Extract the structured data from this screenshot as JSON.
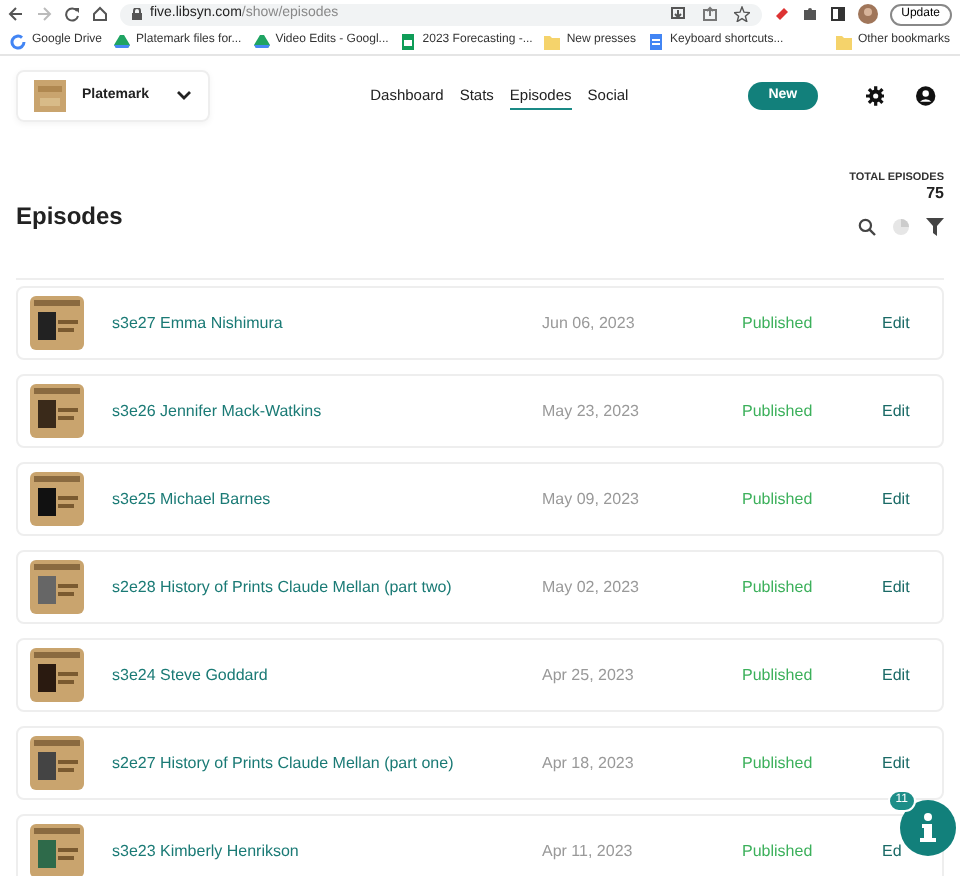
{
  "browser": {
    "url_host": "five.libsyn.com",
    "url_path": "/show/episodes",
    "update_label": "Update",
    "bookmarks": [
      {
        "label": "Google Drive",
        "kind": "google"
      },
      {
        "label": "Platemark files for...",
        "kind": "drive"
      },
      {
        "label": "Video Edits - Googl...",
        "kind": "drive"
      },
      {
        "label": "2023 Forecasting -...",
        "kind": "sheet"
      },
      {
        "label": "New presses",
        "kind": "folder"
      },
      {
        "label": "Keyboard shortcuts...",
        "kind": "doc"
      }
    ],
    "other_bookmarks": "Other bookmarks"
  },
  "show_selector": {
    "name": "Platemark"
  },
  "nav": [
    {
      "label": "Dashboard",
      "selected": false
    },
    {
      "label": "Stats",
      "selected": false
    },
    {
      "label": "Episodes",
      "selected": true
    },
    {
      "label": "Social",
      "selected": false
    }
  ],
  "new_button": "New",
  "page_title": "Episodes",
  "total": {
    "label": "TOTAL EPISODES",
    "value": "75"
  },
  "episodes": [
    {
      "title": "s3e27 Emma Nishimura",
      "date": "Jun 06, 2023",
      "status": "Published",
      "action": "Edit"
    },
    {
      "title": "s3e26 Jennifer Mack-Watkins",
      "date": "May 23, 2023",
      "status": "Published",
      "action": "Edit"
    },
    {
      "title": "s3e25 Michael Barnes",
      "date": "May 09, 2023",
      "status": "Published",
      "action": "Edit"
    },
    {
      "title": "s2e28 History of Prints Claude Mellan (part two)",
      "date": "May 02, 2023",
      "status": "Published",
      "action": "Edit"
    },
    {
      "title": "s3e24 Steve Goddard",
      "date": "Apr 25, 2023",
      "status": "Published",
      "action": "Edit"
    },
    {
      "title": "s2e27 History of Prints Claude Mellan (part one)",
      "date": "Apr 18, 2023",
      "status": "Published",
      "action": "Edit"
    },
    {
      "title": "s3e23 Kimberly Henrikson",
      "date": "Apr 11, 2023",
      "status": "Published",
      "action": "Ed"
    }
  ],
  "help_badge": "11"
}
